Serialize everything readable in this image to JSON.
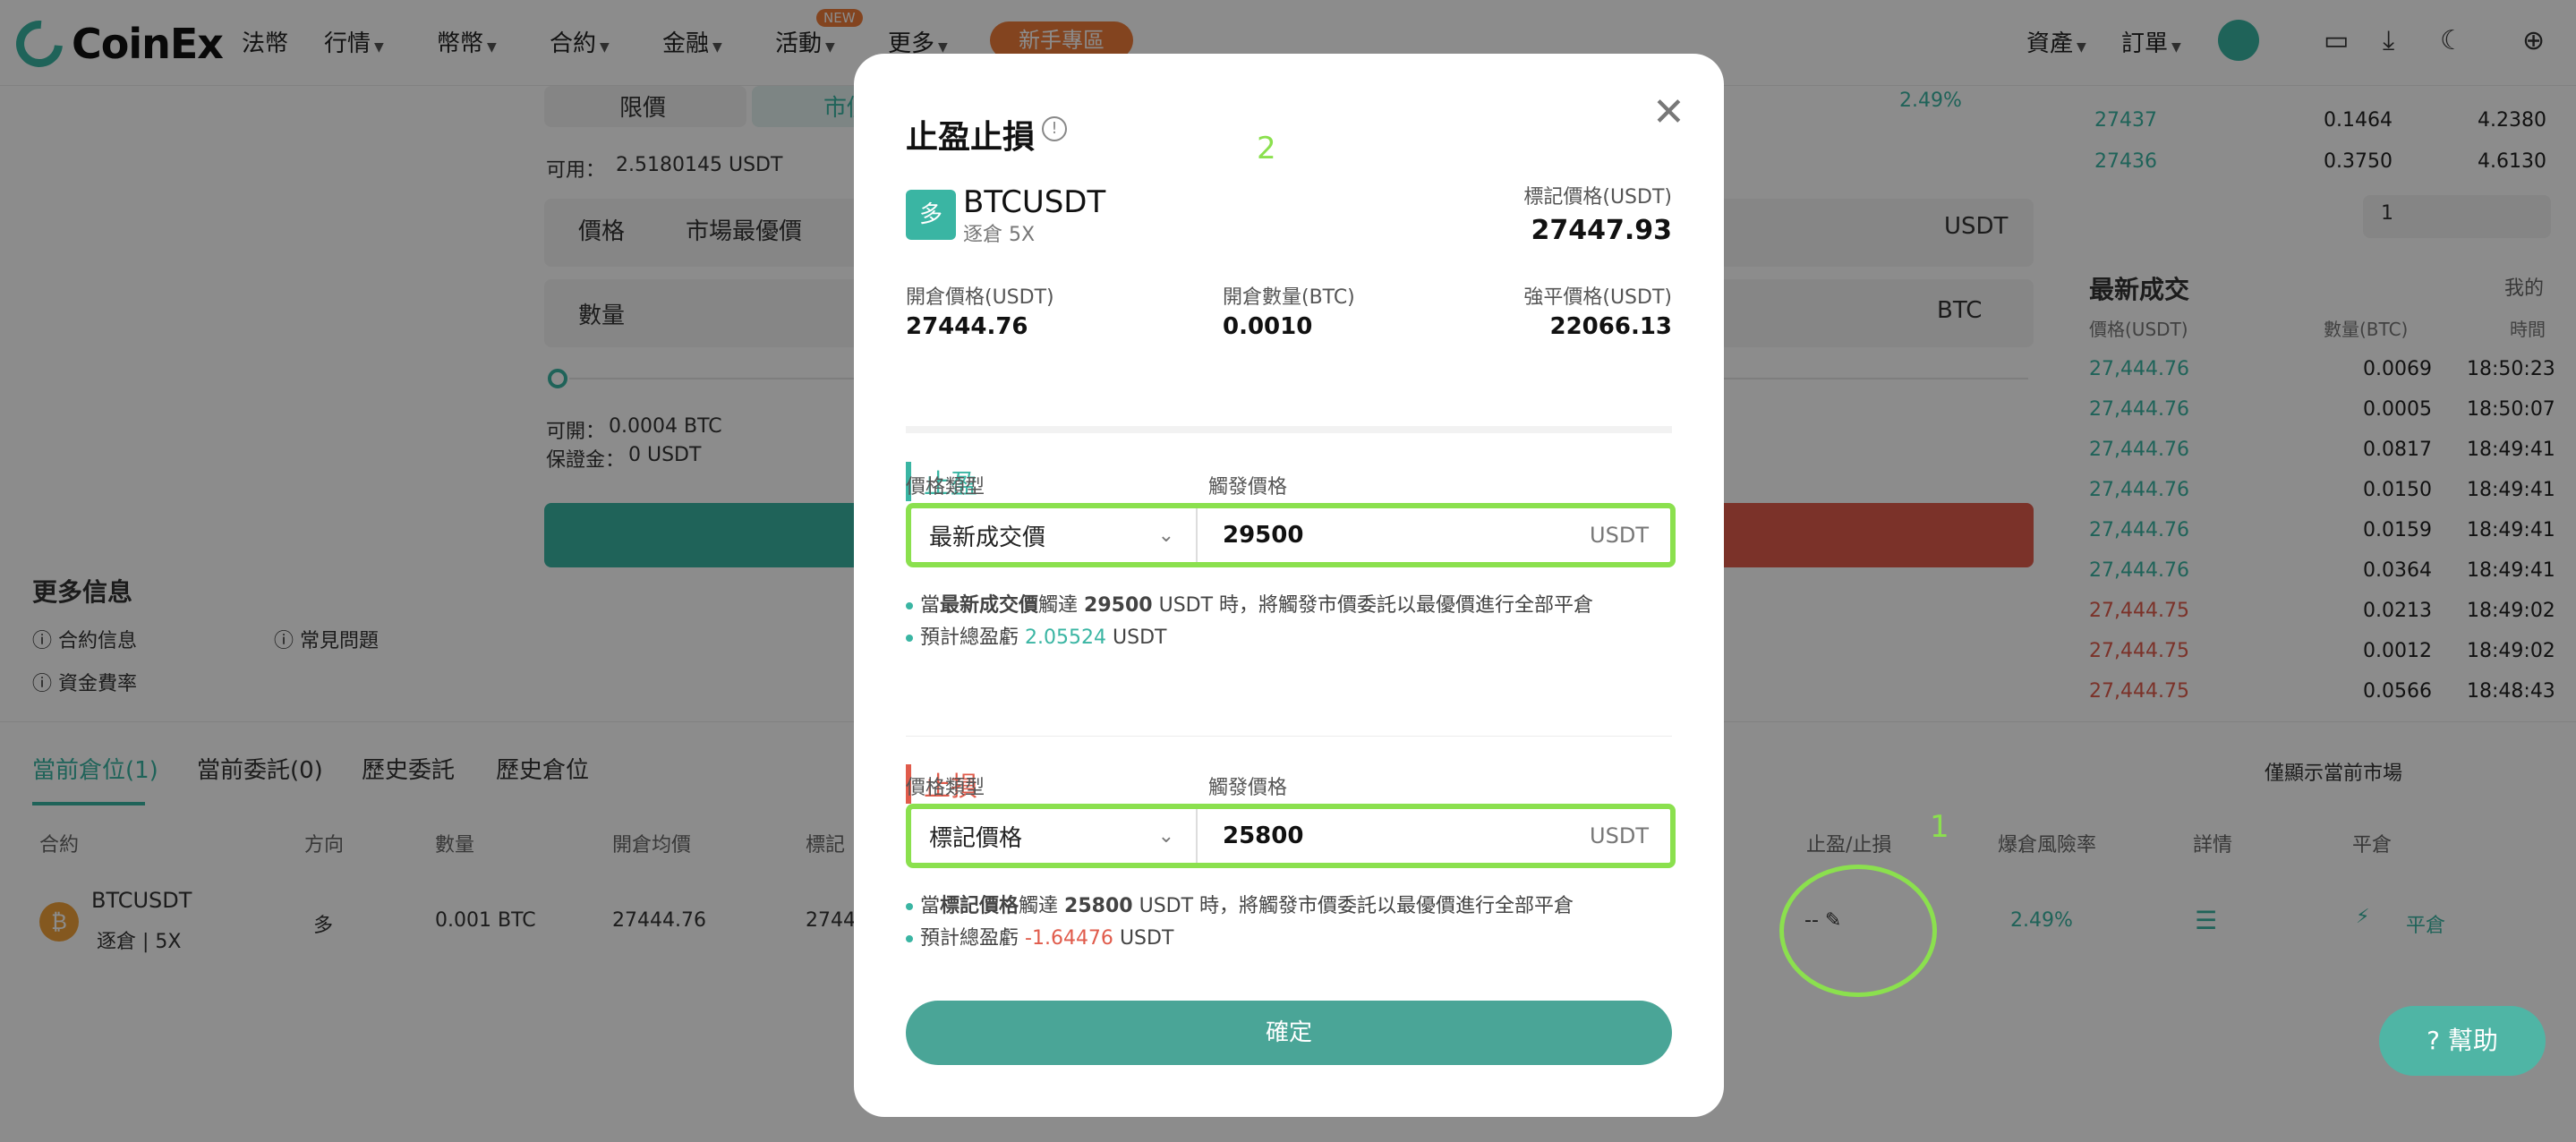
{
  "header": {
    "brand": "CoinEx",
    "nav": [
      "法幣",
      "行情",
      "幣幣",
      "合約",
      "金融",
      "活動",
      "更多"
    ],
    "new_badge": "NEW",
    "new_user": "新手專區",
    "assets": "資產",
    "orders": "訂單"
  },
  "order_panel": {
    "tab_limit": "限價",
    "tab_market": "市價",
    "available_label": "可用：",
    "available_value": "2.5180145 USDT",
    "price_label": "價格",
    "price_best": "市場最優價",
    "price_unit": "USDT",
    "qty_label": "數量",
    "qty_unit": "BTC",
    "openable_label": "可開：",
    "openable_value": "0.0004 BTC",
    "margin_label": "保證金：",
    "margin_value": "0 USDT",
    "risk_value": "2.49%"
  },
  "more_info": {
    "title": "更多信息",
    "contract_info": "合約信息",
    "faq": "常見問題",
    "funding_rate": "資金費率"
  },
  "orderbook": {
    "rows": [
      {
        "price": "27437",
        "qty": "0.1464",
        "total": "4.2380"
      },
      {
        "price": "27436",
        "qty": "0.3750",
        "total": "4.6130"
      }
    ],
    "depth": "1"
  },
  "trades": {
    "title": "最新成交",
    "mine": "我的",
    "col_price": "價格(USDT)",
    "col_qty": "數量(BTC)",
    "col_time": "時間",
    "rows": [
      {
        "price": "27,444.76",
        "qty": "0.0069",
        "time": "18:50:23",
        "side": "buy"
      },
      {
        "price": "27,444.76",
        "qty": "0.0005",
        "time": "18:50:07",
        "side": "buy"
      },
      {
        "price": "27,444.76",
        "qty": "0.0817",
        "time": "18:49:41",
        "side": "buy"
      },
      {
        "price": "27,444.76",
        "qty": "0.0150",
        "time": "18:49:41",
        "side": "buy"
      },
      {
        "price": "27,444.76",
        "qty": "0.0159",
        "time": "18:49:41",
        "side": "buy"
      },
      {
        "price": "27,444.76",
        "qty": "0.0364",
        "time": "18:49:41",
        "side": "buy"
      },
      {
        "price": "27,444.75",
        "qty": "0.0213",
        "time": "18:49:02",
        "side": "sell"
      },
      {
        "price": "27,444.75",
        "qty": "0.0012",
        "time": "18:49:02",
        "side": "sell"
      },
      {
        "price": "27,444.75",
        "qty": "0.0566",
        "time": "18:48:43",
        "side": "sell"
      }
    ]
  },
  "positions": {
    "tabs": [
      "當前倉位(1)",
      "當前委託(0)",
      "歷史委託",
      "歷史倉位"
    ],
    "only_current": "僅顯示當前市場",
    "cols": {
      "contract": "合約",
      "side": "方向",
      "qty": "數量",
      "open_avg": "開倉均價",
      "mark": "標記",
      "tpsl": "止盈/止損",
      "risk": "爆倉風險率",
      "detail": "詳情",
      "close": "平倉"
    },
    "row": {
      "symbol": "BTCUSDT",
      "mode": "逐倉 | 5X",
      "side": "多",
      "qty": "0.001 BTC",
      "open_avg": "27444.76",
      "mark": "2744",
      "tpsl": "--",
      "risk": "2.49%",
      "close": "平倉"
    }
  },
  "modal": {
    "title": "止盈止損",
    "badge": "多",
    "symbol": "BTCUSDT",
    "mode": "逐倉 5X",
    "mark_price_label": "標記價格(USDT)",
    "mark_price": "27447.93",
    "open_price_label": "開倉價格(USDT)",
    "open_price": "27444.76",
    "open_qty_label": "開倉數量(BTC)",
    "open_qty": "0.0010",
    "liq_price_label": "強平價格(USDT)",
    "liq_price": "22066.13",
    "tp": {
      "title": "止盈",
      "type_label": "價格類型",
      "trigger_label": "觸發價格",
      "type_value": "最新成交價",
      "trigger_value": "29500",
      "unit": "USDT",
      "note_pre": "當",
      "note_type": "最新成交價",
      "note_mid": "觸達",
      "note_value": "29500",
      "note_post": "USDT 時，將觸發市價委託以最優價進行全部平倉",
      "pnl_label": "預計總盈虧",
      "pnl_value": "2.05524",
      "pnl_unit": "USDT"
    },
    "sl": {
      "title": "止損",
      "type_label": "價格類型",
      "trigger_label": "觸發價格",
      "type_value": "標記價格",
      "trigger_value": "25800",
      "unit": "USDT",
      "note_pre": "當",
      "note_type": "標記價格",
      "note_mid": "觸達",
      "note_value": "25800",
      "note_post": "USDT 時，將觸發市價委託以最優價進行全部平倉",
      "pnl_label": "預計總盈虧",
      "pnl_value": "-1.64476",
      "pnl_unit": "USDT"
    },
    "confirm": "確定"
  },
  "annotations": {
    "one": "1",
    "two": "2"
  },
  "help": "幫助"
}
